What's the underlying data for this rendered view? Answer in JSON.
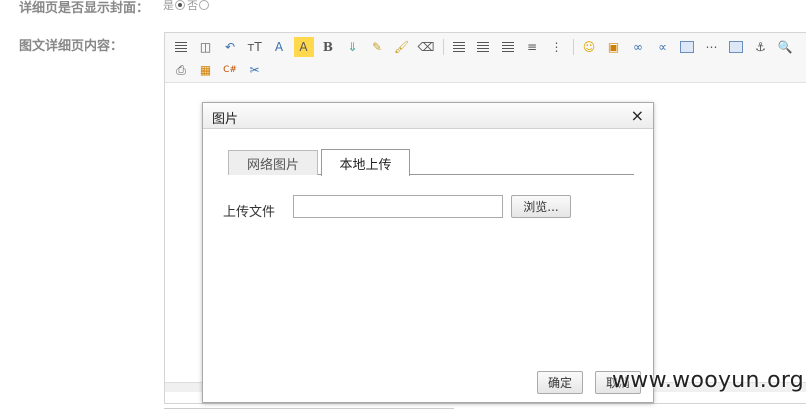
{
  "form": {
    "cover_label": "详细页是否显示封面：",
    "cover_options": [
      {
        "label": "是",
        "checked": true
      },
      {
        "label": "否",
        "checked": false
      }
    ],
    "content_label": "图文详细页内容："
  },
  "toolbar": {
    "font_size_glyph": "тT",
    "font_color_glyph": "A",
    "bg_color_glyph": "A",
    "bold_glyph": "B"
  },
  "dialog": {
    "title": "图片",
    "close_glyph": "×",
    "tabs": [
      {
        "label": "网络图片",
        "active": false
      },
      {
        "label": "本地上传",
        "active": true
      }
    ],
    "upload_label": "上传文件",
    "upload_value": "",
    "browse_label": "浏览...",
    "ok_label": "确定",
    "cancel_label": "取消"
  },
  "watermark": "www.wooyun.org",
  "colors": {
    "label": "#888888",
    "dialog_border": "#aaaaaa",
    "toolbar_bg": "#f7f7f7"
  }
}
